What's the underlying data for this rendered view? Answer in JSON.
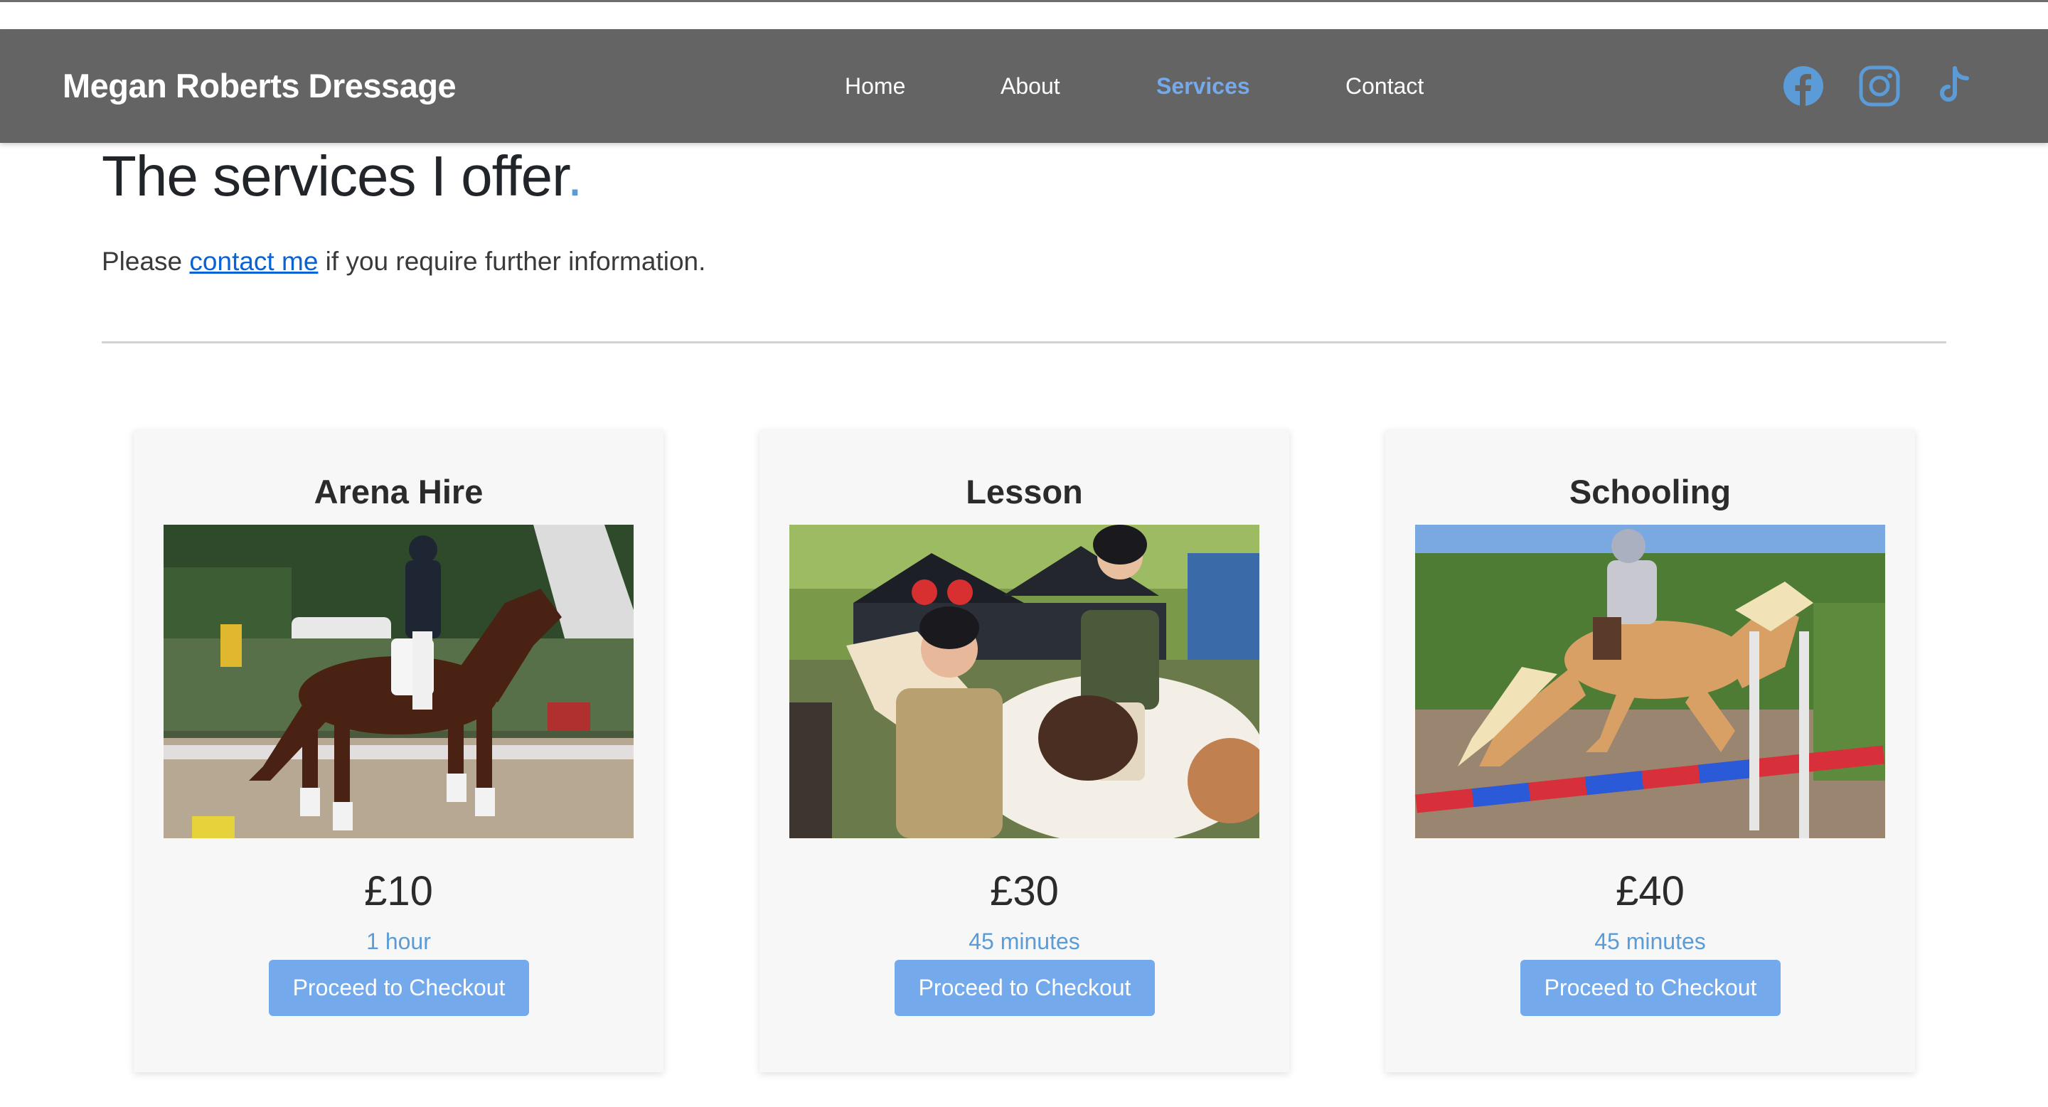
{
  "navbar": {
    "brand": "Megan Roberts Dressage",
    "links": [
      {
        "label": "Home"
      },
      {
        "label": "About"
      },
      {
        "label": "Services",
        "active": true
      },
      {
        "label": "Contact"
      }
    ],
    "social_icons": [
      "facebook-icon",
      "instagram-icon",
      "tiktok-icon"
    ],
    "social_color": "#5b9bd8",
    "background": "#646464",
    "active_color": "#74aaeb"
  },
  "page": {
    "title": "The services I offer",
    "title_dot": ".",
    "intro_before": "Please ",
    "intro_link": "contact me",
    "intro_after": " if you require further information."
  },
  "services": [
    {
      "title": "Arena Hire",
      "image": "horse-dressage-photo",
      "price": "£10",
      "duration": "1 hour",
      "button": "Proceed to Checkout"
    },
    {
      "title": "Lesson",
      "image": "pony-lesson-photo",
      "price": "£30",
      "duration": "45 minutes",
      "button": "Proceed to Checkout"
    },
    {
      "title": "Schooling",
      "image": "pony-jumping-photo",
      "price": "£40",
      "duration": "45 minutes",
      "button": "Proceed to Checkout"
    }
  ],
  "colors": {
    "accent": "#74aaeb",
    "link": "#0a63d6"
  }
}
